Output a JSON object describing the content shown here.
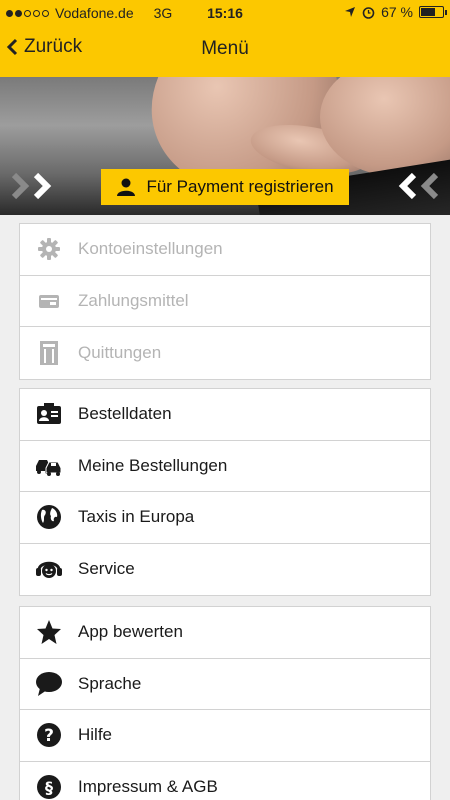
{
  "status": {
    "carrier": "Vodafone.de",
    "network": "3G",
    "time": "15:16",
    "battery_text": "67 %",
    "battery_level": 0.67
  },
  "nav": {
    "back_label": "Zurück",
    "title": "Menü"
  },
  "hero": {
    "register_label": "Für Payment registrieren"
  },
  "groups": [
    {
      "items": [
        {
          "label": "Kontoeinstellungen",
          "icon": "gear-icon",
          "enabled": false
        },
        {
          "label": "Zahlungsmittel",
          "icon": "wallet-icon",
          "enabled": false
        },
        {
          "label": "Quittungen",
          "icon": "receipt-icon",
          "enabled": false
        }
      ]
    },
    {
      "items": [
        {
          "label": "Bestelldaten",
          "icon": "id-card-icon",
          "enabled": true
        },
        {
          "label": "Meine Bestellungen",
          "icon": "taxis-icon",
          "enabled": true
        },
        {
          "label": "Taxis in Europa",
          "icon": "globe-icon",
          "enabled": true
        },
        {
          "label": "Service",
          "icon": "headset-icon",
          "enabled": true
        }
      ]
    },
    {
      "items": [
        {
          "label": "App bewerten",
          "icon": "star-icon",
          "enabled": true
        },
        {
          "label": "Sprache",
          "icon": "speech-bubble-icon",
          "enabled": true
        },
        {
          "label": "Hilfe",
          "icon": "question-icon",
          "enabled": true
        },
        {
          "label": "Impressum & AGB",
          "icon": "paragraph-icon",
          "enabled": true
        }
      ]
    }
  ],
  "colors": {
    "accent": "#fcc800",
    "text": "#1a1a1a",
    "disabled": "#b4b4b4",
    "background": "#efefef"
  }
}
